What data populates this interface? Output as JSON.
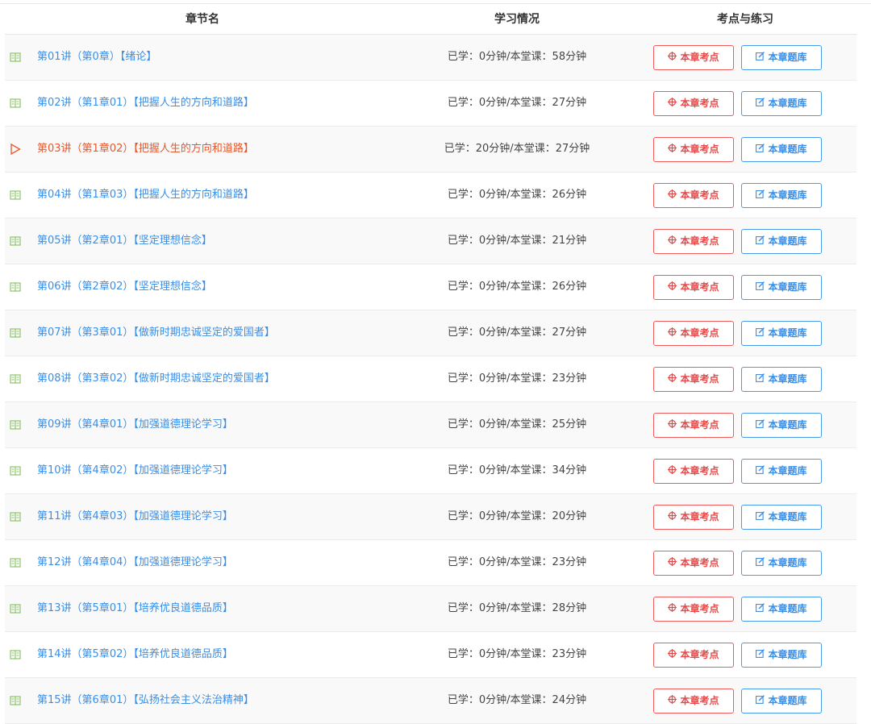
{
  "header": {
    "col_chapter": "章节名",
    "col_study": "学习情况",
    "col_practice": "考点与练习"
  },
  "buttons": {
    "key_points": "本章考点",
    "question_bank": "本章题库"
  },
  "colors": {
    "link_blue": "#3a8ee6",
    "active_orange": "#e8572a",
    "red_button": "#e84848",
    "book_icon_green": "#8cc46a"
  },
  "rows": [
    {
      "title": "第01讲（第0章）【绪论】",
      "study": "已学：0分钟/本堂课：58分钟",
      "icon": "book-icon"
    },
    {
      "title": "第02讲（第1章01）【把握人生的方向和道路】",
      "study": "已学：0分钟/本堂课：27分钟",
      "icon": "book-icon"
    },
    {
      "title": "第03讲（第1章02）【把握人生的方向和道路】",
      "study": "已学：20分钟/本堂课：27分钟",
      "icon": "play-icon",
      "active": true
    },
    {
      "title": "第04讲（第1章03）【把握人生的方向和道路】",
      "study": "已学：0分钟/本堂课：26分钟",
      "icon": "book-icon"
    },
    {
      "title": "第05讲（第2章01）【坚定理想信念】",
      "study": "已学：0分钟/本堂课：21分钟",
      "icon": "book-icon"
    },
    {
      "title": "第06讲（第2章02）【坚定理想信念】",
      "study": "已学：0分钟/本堂课：26分钟",
      "icon": "book-icon"
    },
    {
      "title": "第07讲（第3章01）【做新时期忠诚坚定的爱国者】",
      "study": "已学：0分钟/本堂课：27分钟",
      "icon": "book-icon"
    },
    {
      "title": "第08讲（第3章02）【做新时期忠诚坚定的爱国者】",
      "study": "已学：0分钟/本堂课：23分钟",
      "icon": "book-icon"
    },
    {
      "title": "第09讲（第4章01）【加强道德理论学习】",
      "study": "已学：0分钟/本堂课：25分钟",
      "icon": "book-icon"
    },
    {
      "title": "第10讲（第4章02）【加强道德理论学习】",
      "study": "已学：0分钟/本堂课：34分钟",
      "icon": "book-icon"
    },
    {
      "title": "第11讲（第4章03）【加强道德理论学习】",
      "study": "已学：0分钟/本堂课：20分钟",
      "icon": "book-icon"
    },
    {
      "title": "第12讲（第4章04）【加强道德理论学习】",
      "study": "已学：0分钟/本堂课：23分钟",
      "icon": "book-icon"
    },
    {
      "title": "第13讲（第5章01）【培养优良道德品质】",
      "study": "已学：0分钟/本堂课：28分钟",
      "icon": "book-icon"
    },
    {
      "title": "第14讲（第5章02）【培养优良道德品质】",
      "study": "已学：0分钟/本堂课：23分钟",
      "icon": "book-icon"
    },
    {
      "title": "第15讲（第6章01）【弘扬社会主义法治精神】",
      "study": "已学：0分钟/本堂课：24分钟",
      "icon": "book-icon"
    }
  ]
}
